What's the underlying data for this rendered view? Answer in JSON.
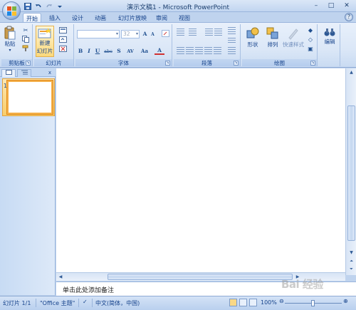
{
  "window": {
    "title": "演示文稿1 - Microsoft PowerPoint",
    "minimize": "–",
    "maximize": "□",
    "close": "✕"
  },
  "qat": {
    "save_icon": "save-icon",
    "undo_icon": "undo-icon",
    "redo_icon": "redo-icon",
    "customize_icon": "dropdown-icon"
  },
  "tabs": [
    "开始",
    "插入",
    "设计",
    "动画",
    "幻灯片放映",
    "审阅",
    "视图"
  ],
  "active_tab": "开始",
  "ribbon": {
    "clipboard": {
      "label": "剪贴板",
      "paste": "粘贴"
    },
    "slides": {
      "label": "幻灯片",
      "new_slide_line1": "新建",
      "new_slide_line2": "幻灯片"
    },
    "font": {
      "label": "字体",
      "font_size": "32",
      "bold": "B",
      "italic": "I",
      "underline": "U",
      "strikethrough": "abc",
      "shadow": "S",
      "spacing": "AV",
      "case": "Aa",
      "color": "A",
      "grow": "A",
      "shrink": "A"
    },
    "paragraph": {
      "label": "段落"
    },
    "drawing": {
      "label": "绘图",
      "shapes": "形状",
      "arrange": "排列",
      "quick_styles": "快速样式"
    },
    "editing": {
      "label": "编辑"
    }
  },
  "panel": {
    "slide_number": "1",
    "close": "x"
  },
  "notes": {
    "placeholder": "单击此处添加备注"
  },
  "statusbar": {
    "slide_info": "幻灯片 1/1",
    "theme": "\"Office 主题\"",
    "language": "中文(简体，中国)",
    "zoom": "100%"
  },
  "watermark": "Bai 经验",
  "colors": {
    "ribbon": "#dbe7f7",
    "frame": "#bfd3ee",
    "selection": "#f9cd6a"
  }
}
